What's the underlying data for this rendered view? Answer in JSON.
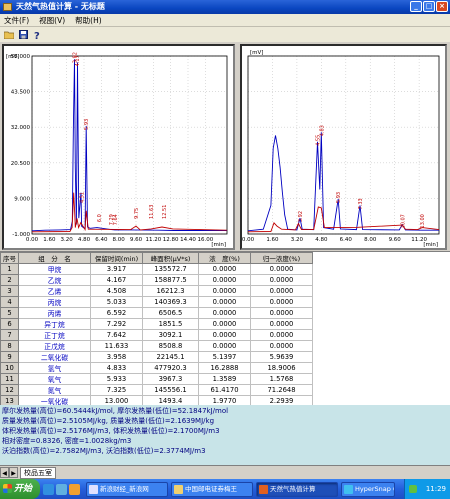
{
  "window": {
    "title": "天然气热值计算 - 无标题"
  },
  "window_buttons": [
    "_",
    "□",
    "×"
  ],
  "menu": [
    "文件(F)",
    "视图(V)",
    "帮助(H)"
  ],
  "toolbar_icons": [
    "open-icon",
    "save-icon",
    "help-icon"
  ],
  "chart_data": [
    {
      "type": "line",
      "title": "",
      "xlabel": "[min]",
      "ylabel": "[mV]",
      "xlim": [
        0,
        18
      ],
      "ylim": [
        -1,
        55
      ],
      "yticks": [
        "55.000",
        "43.500",
        "32.000",
        "20.500",
        "9.000",
        "-1.000"
      ],
      "xticks": [
        "0.00",
        "1.60",
        "3.20",
        "4.80",
        "6.40",
        "8.00",
        "9.60",
        "11.20",
        "12.80",
        "14.40",
        "16.00"
      ],
      "series": [
        {
          "color": "#0000c0",
          "points": [
            [
              0,
              0
            ],
            [
              1.2,
              0.2
            ],
            [
              2.6,
              0.3
            ],
            [
              3.55,
              0.4
            ],
            [
              3.72,
              3
            ],
            [
              3.82,
              33
            ],
            [
              3.92,
              54
            ],
            [
              4.0,
              20
            ],
            [
              4.1,
              2
            ],
            [
              4.2,
              53
            ],
            [
              4.32,
              4
            ],
            [
              4.52,
              12
            ],
            [
              4.58,
              1.5
            ],
            [
              4.9,
              0.6
            ],
            [
              5.0,
              33
            ],
            [
              5.12,
              1.2
            ],
            [
              5.35,
              0.8
            ],
            [
              6.0,
              1
            ],
            [
              7.3,
              0.4
            ],
            [
              7.65,
              0.3
            ],
            [
              9.2,
              0.3
            ],
            [
              11.7,
              0.2
            ],
            [
              13.1,
              0.1
            ],
            [
              18,
              0.1
            ]
          ]
        },
        {
          "color": "#c00000",
          "points": [
            [
              0,
              -0.3
            ],
            [
              3.5,
              -0.2
            ],
            [
              3.7,
              1
            ],
            [
              3.85,
              12
            ],
            [
              3.95,
              5
            ],
            [
              4.0,
              1
            ],
            [
              4.15,
              3.9
            ],
            [
              4.3,
              1
            ],
            [
              4.5,
              2.6
            ],
            [
              4.9,
              0.4
            ],
            [
              5.0,
              6.3
            ],
            [
              5.2,
              0.5
            ],
            [
              9.1,
              0.4
            ],
            [
              9.6,
              1.5
            ],
            [
              10.0,
              0.3
            ],
            [
              11.0,
              0.6
            ],
            [
              12.0,
              1.2
            ],
            [
              13.0,
              0.6
            ],
            [
              18,
              0.2
            ]
          ]
        }
      ],
      "peak_labels": [
        {
          "x": 3.92,
          "y": 54,
          "text": "3.92"
        },
        {
          "x": 4.17,
          "y": 53,
          "text": "4.17"
        },
        {
          "x": 5.0,
          "y": 33,
          "text": "5.93"
        },
        {
          "x": 4.55,
          "y": 10,
          "text": "4.51"
        },
        {
          "x": 6.2,
          "y": 4,
          "text": "6.0"
        },
        {
          "x": 7.3,
          "y": 3,
          "text": "7.29"
        },
        {
          "x": 7.65,
          "y": 3,
          "text": "7.64"
        },
        {
          "x": 9.6,
          "y": 5,
          "text": "9.75"
        },
        {
          "x": 11.0,
          "y": 5,
          "text": "11.63"
        },
        {
          "x": 12.2,
          "y": 5,
          "text": "12.51"
        }
      ]
    },
    {
      "type": "line",
      "title": "",
      "xlabel": "[min]",
      "ylabel": "[mV]",
      "xlim": [
        0,
        12.5
      ],
      "ylim": [
        -1,
        55
      ],
      "yticks": [
        "55.000",
        "43.500",
        "32.000",
        "20.500",
        "9.000",
        "-1.000"
      ],
      "xticks": [
        "0.00",
        "1.60",
        "3.20",
        "4.80",
        "6.40",
        "8.00",
        "9.60",
        "11.20",
        "12.80",
        "14.40",
        "16.00"
      ],
      "series": [
        {
          "color": "#0000c0",
          "points": [
            [
              0,
              0
            ],
            [
              1.0,
              0.5
            ],
            [
              1.5,
              8
            ],
            [
              1.65,
              26
            ],
            [
              1.8,
              30
            ],
            [
              1.95,
              26
            ],
            [
              2.1,
              20
            ],
            [
              2.25,
              12
            ],
            [
              2.4,
              5
            ],
            [
              2.6,
              0.5
            ],
            [
              3.2,
              0.3
            ],
            [
              3.4,
              4
            ],
            [
              3.55,
              0.5
            ],
            [
              4.3,
              0.4
            ],
            [
              4.55,
              28
            ],
            [
              4.7,
              13
            ],
            [
              4.8,
              31
            ],
            [
              4.95,
              1
            ],
            [
              5.6,
              0.5
            ],
            [
              5.9,
              10
            ],
            [
              6.05,
              0.6
            ],
            [
              7.1,
              0.4
            ],
            [
              7.33,
              8
            ],
            [
              7.5,
              0.4
            ],
            [
              9.9,
              0.3
            ],
            [
              10.1,
              2
            ],
            [
              10.3,
              0.3
            ],
            [
              11.4,
              0.2
            ],
            [
              12.5,
              0.2
            ]
          ]
        },
        {
          "color": "#c00000",
          "points": [
            [
              0,
              -0.3
            ],
            [
              1.5,
              -0.2
            ],
            [
              1.7,
              2.5
            ],
            [
              1.9,
              1.5
            ],
            [
              2.2,
              0.5
            ],
            [
              3.1,
              0.3
            ],
            [
              3.3,
              2.3
            ],
            [
              3.5,
              0.4
            ],
            [
              4.3,
              0.4
            ],
            [
              4.6,
              7.5
            ],
            [
              4.8,
              7.2
            ],
            [
              5.0,
              1
            ],
            [
              6.0,
              1
            ],
            [
              7.2,
              1.1
            ],
            [
              10.1,
              1.8
            ],
            [
              10.3,
              0.5
            ],
            [
              11.1,
              0.4
            ],
            [
              11.4,
              1
            ],
            [
              12.5,
              0.4
            ]
          ]
        }
      ],
      "peak_labels": [
        {
          "x": 4.55,
          "y": 28,
          "text": "4.55"
        },
        {
          "x": 4.8,
          "y": 31,
          "text": "4.83"
        },
        {
          "x": 3.4,
          "y": 4,
          "text": "3.92"
        },
        {
          "x": 5.9,
          "y": 10,
          "text": "5.93"
        },
        {
          "x": 7.33,
          "y": 8,
          "text": "7.33"
        },
        {
          "x": 10.1,
          "y": 2,
          "text": "10.07"
        },
        {
          "x": 11.4,
          "y": 2,
          "text": "13.00"
        }
      ]
    }
  ],
  "table": {
    "headers": [
      "序号",
      "组　分　名",
      "保留时间(min)",
      "峰面积(μV*s)",
      "浓　度(%)",
      "归一浓度(%)"
    ],
    "rows": [
      [
        "1",
        "甲烷",
        "3.917",
        "135572.7",
        "0.0000",
        "0.0000"
      ],
      [
        "2",
        "乙烷",
        "4.167",
        "158877.5",
        "0.0000",
        "0.0000"
      ],
      [
        "3",
        "乙烯",
        "4.508",
        "16212.3",
        "0.0000",
        "0.0000"
      ],
      [
        "4",
        "丙烷",
        "5.033",
        "140369.3",
        "0.0000",
        "0.0000"
      ],
      [
        "5",
        "丙烯",
        "6.592",
        "6506.5",
        "0.0000",
        "0.0000"
      ],
      [
        "6",
        "异丁烷",
        "7.292",
        "1851.5",
        "0.0000",
        "0.0000"
      ],
      [
        "7",
        "正丁烷",
        "7.642",
        "3092.1",
        "0.0000",
        "0.0000"
      ],
      [
        "8",
        "正戊烷",
        "11.633",
        "8508.8",
        "0.0000",
        "0.0000"
      ],
      [
        "9",
        "二氧化碳",
        "3.958",
        "22145.1",
        "5.1397",
        "5.9639"
      ],
      [
        "10",
        "氢气",
        "4.833",
        "477920.3",
        "16.2888",
        "18.9006"
      ],
      [
        "11",
        "氧气",
        "5.933",
        "3967.3",
        "1.3589",
        "1.5768"
      ],
      [
        "12",
        "氮气",
        "7.325",
        "145556.1",
        "61.4170",
        "71.2648"
      ],
      [
        "13",
        "一氧化碳",
        "13.000",
        "1493.4",
        "1.9770",
        "2.2939"
      ]
    ]
  },
  "results": [
    "摩尔发热量(高位)=60.5444kJ/mol, 摩尔发热量(低位)=52.1847kJ/mol",
    "质量发热量(高位)=2.5105MJ/kg, 质量发热量(低位)=2.1639MJ/kg",
    "体积发热量(高位)=2.5176MJ/m3, 体积发热量(低位)=2.1700MJ/m3",
    "相对密度=0.8326, 密度=1.0028kg/m3",
    "沃泊指数(高位)=2.7582MJ/m3, 沃泊指数(低位)=2.3774MJ/m3"
  ],
  "bottom_tabs": {
    "nav": [
      "◀",
      "▶"
    ],
    "tab": "校品五室"
  },
  "taskbar": {
    "start": "开始",
    "tasks": [
      {
        "label": "新浪财经_新浪网",
        "color": "#e0e0ff",
        "active": false
      },
      {
        "label": "中国邮电证券梅王",
        "color": "#f0d070",
        "active": false
      },
      {
        "label": "天然气热值计算",
        "color": "#e06020",
        "active": true
      },
      {
        "label": "HyperSnap 6",
        "color": "#40c0f0",
        "active": false
      }
    ],
    "clock": "11:29"
  }
}
